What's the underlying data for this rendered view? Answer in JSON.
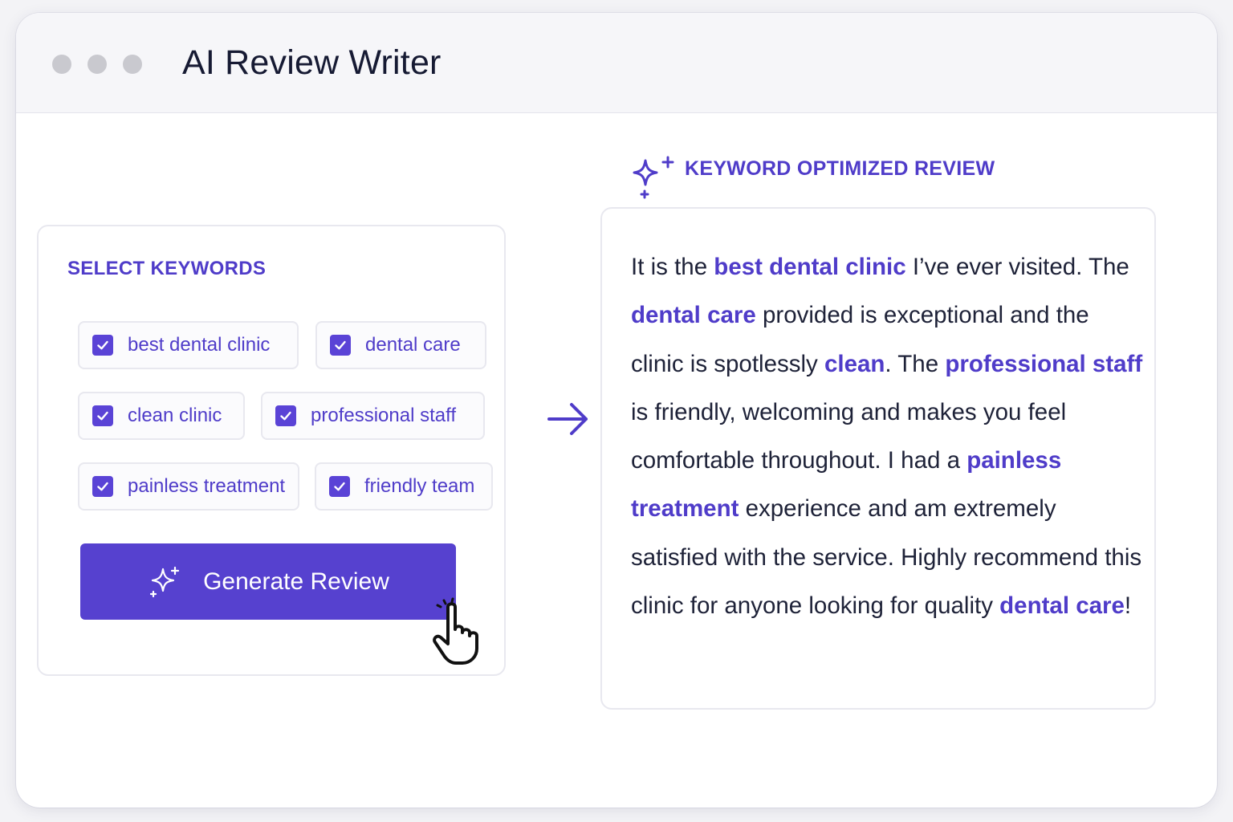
{
  "window": {
    "title": "AI Review Writer"
  },
  "keywords_panel": {
    "label": "SELECT KEYWORDS",
    "keywords": [
      {
        "label": "best dental clinic",
        "checked": true
      },
      {
        "label": "dental care",
        "checked": true
      },
      {
        "label": "clean clinic",
        "checked": true
      },
      {
        "label": "professional staff",
        "checked": true
      },
      {
        "label": "painless treatment",
        "checked": true
      },
      {
        "label": "friendly team",
        "checked": true
      }
    ],
    "generate_button": "Generate Review"
  },
  "review_panel": {
    "label": "KEYWORD OPTIMIZED REVIEW",
    "segments": [
      {
        "text": "It is the ",
        "keyword": false
      },
      {
        "text": "best dental clinic",
        "keyword": true
      },
      {
        "text": " I’ve ever visited. The ",
        "keyword": false
      },
      {
        "text": "dental care",
        "keyword": true
      },
      {
        "text": " provided is exceptional and the clinic is spotlessly ",
        "keyword": false
      },
      {
        "text": "clean",
        "keyword": true
      },
      {
        "text": ". The ",
        "keyword": false
      },
      {
        "text": "professional staff",
        "keyword": true
      },
      {
        "text": " is friendly, welcoming and makes you feel comfortable throughout. I had a ",
        "keyword": false
      },
      {
        "text": "painless treatment",
        "keyword": true
      },
      {
        "text": " experience and am extremely satisfied with the service. Highly recommend this clinic for anyone looking for quality ",
        "keyword": false
      },
      {
        "text": "dental care",
        "keyword": true
      },
      {
        "text": "!",
        "keyword": false
      }
    ]
  },
  "colors": {
    "accent": "#5641cf",
    "text": "#1e2238",
    "border": "#e8e8ef"
  },
  "icons": [
    "window-dot",
    "check-icon",
    "sparkle-icon",
    "hand-pointer-icon",
    "arrow-right-icon"
  ]
}
